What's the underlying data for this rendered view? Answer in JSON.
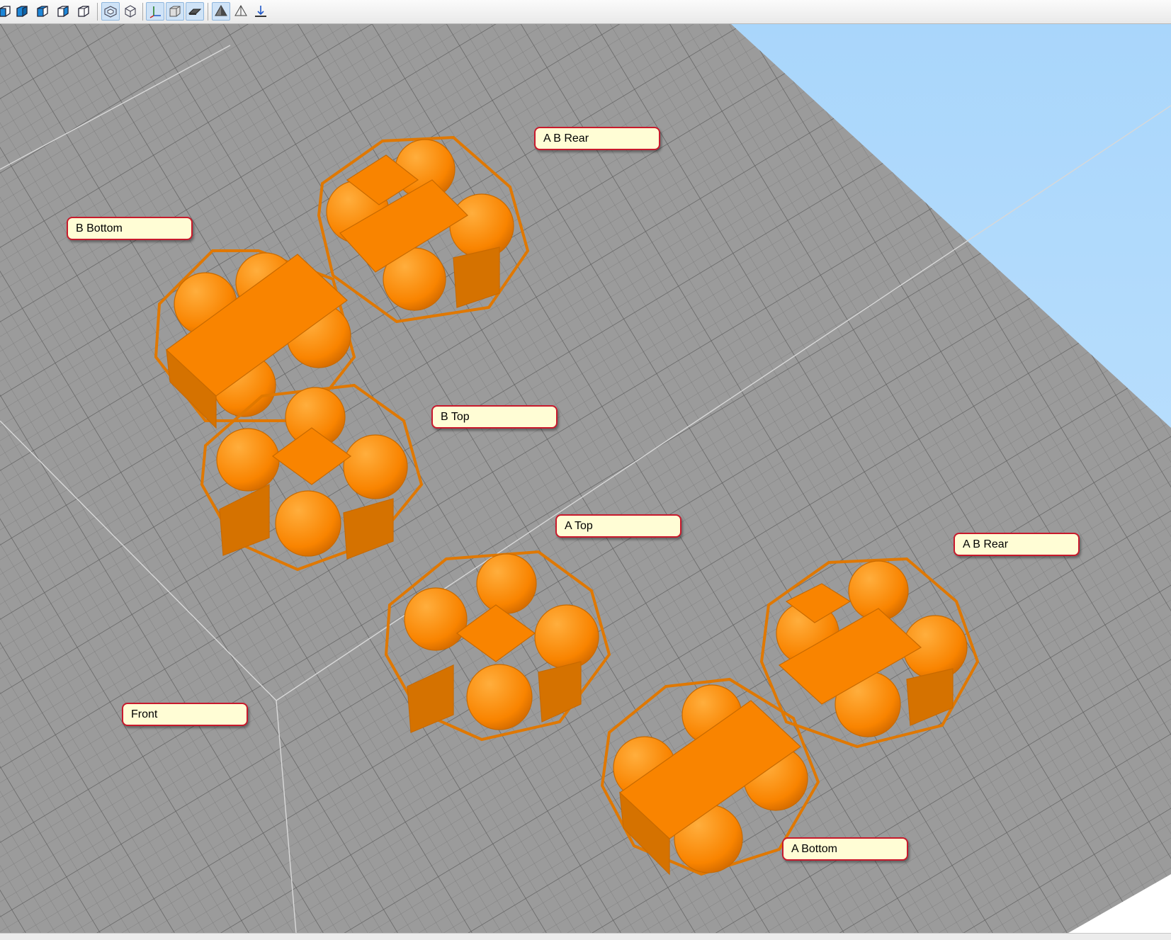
{
  "toolbar": {
    "buttons": [
      {
        "id": "view-front",
        "icon": "cube-front-view-icon"
      },
      {
        "id": "view-back",
        "icon": "cube-back-view-icon"
      },
      {
        "id": "view-left",
        "icon": "cube-left-view-icon"
      },
      {
        "id": "view-right",
        "icon": "cube-right-view-icon"
      },
      {
        "id": "view-iso",
        "icon": "cube-iso-view-icon"
      },
      {
        "id": "perspective",
        "icon": "perspective-icon"
      },
      {
        "id": "orthographic",
        "icon": "orthographic-icon"
      },
      {
        "id": "show-axes",
        "icon": "axes-icon"
      },
      {
        "id": "show-build-volume",
        "icon": "build-volume-icon"
      },
      {
        "id": "show-bed",
        "icon": "print-bed-icon"
      },
      {
        "id": "shaded",
        "icon": "shaded-icon"
      },
      {
        "id": "wireframe",
        "icon": "wireframe-icon"
      },
      {
        "id": "drop-to-bed",
        "icon": "drop-to-bed-icon"
      }
    ]
  },
  "viewport": {
    "colors": {
      "sky": "#b3dcfd",
      "bed": "#9b9b9b",
      "grid": "#6e6e6e",
      "part": "#ff8a00",
      "label_border": "#c8192c",
      "label_fill": "#fffdd5"
    },
    "labels": {
      "ab_rear_top": "A B Rear",
      "b_bottom": "B Bottom",
      "b_top": "B Top",
      "a_top": "A Top",
      "ab_rear_right": "A B Rear",
      "front": "Front",
      "a_bottom": "A Bottom"
    }
  }
}
